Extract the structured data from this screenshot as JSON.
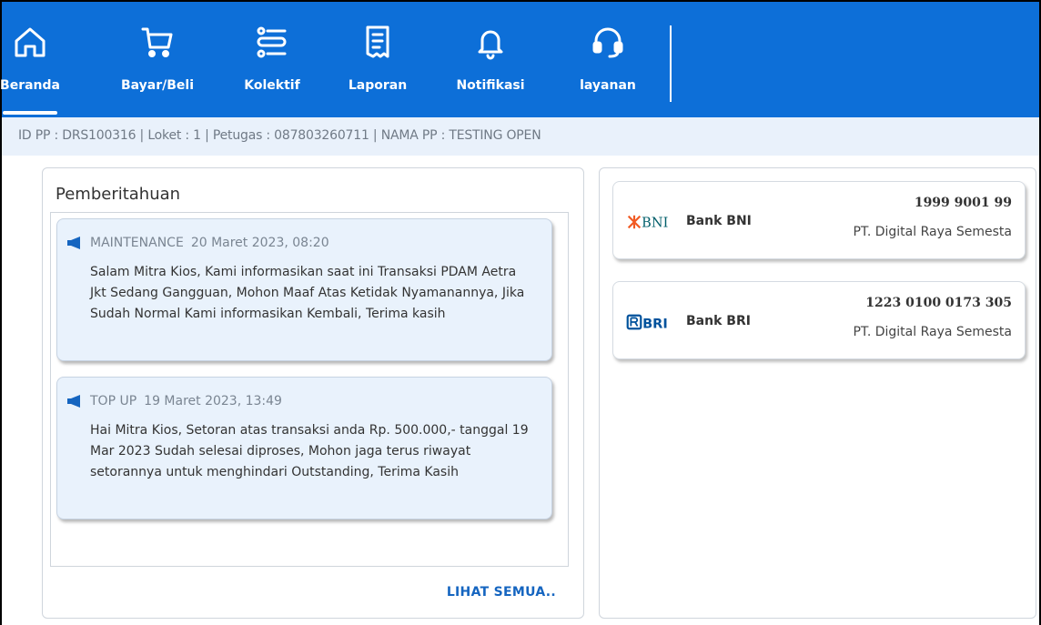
{
  "nav": {
    "items": [
      {
        "label": "Beranda",
        "icon": "home-icon"
      },
      {
        "label": "Bayar/Beli",
        "icon": "cart-icon"
      },
      {
        "label": "Kolektif",
        "icon": "list-icon"
      },
      {
        "label": "Laporan",
        "icon": "report-icon"
      },
      {
        "label": "Notifikasi",
        "icon": "bell-icon"
      },
      {
        "label": "layanan",
        "icon": "headset-icon"
      }
    ],
    "active": "Beranda"
  },
  "info_bar": {
    "text": "ID PP : DRS100316 | Loket : 1 | Petugas : 087803260711 | NAMA PP : TESTING OPEN"
  },
  "announcements": {
    "title": "Pemberitahuan",
    "items": [
      {
        "category": "MAINTENANCE",
        "datetime": "20 Maret 2023, 08:20",
        "message": "Salam Mitra Kios, Kami informasikan saat ini Transaksi PDAM Aetra Jkt Sedang Gangguan, Mohon Maaf Atas Ketidak Nyamanannya, Jika Sudah Normal Kami informasikan Kembali, Terima kasih"
      },
      {
        "category": "TOP UP",
        "datetime": "19 Maret 2023, 13:49",
        "message": "Hai Mitra Kios, Setoran atas transaksi anda Rp. 500.000,- tanggal 19 Mar 2023 Sudah selesai diproses, Mohon jaga terus riwayat setorannya untuk menghindari Outstanding, Terima Kasih"
      }
    ],
    "see_all": "LIHAT SEMUA.."
  },
  "banks": [
    {
      "logo_text": "BNI",
      "name": "Bank BNI",
      "account_number": "1999 9001 99",
      "account_owner": "PT. Digital Raya Semesta"
    },
    {
      "logo_text": "BRI",
      "name": "Bank BRI",
      "account_number": "1223 0100 0173 305",
      "account_owner": "PT. Digital Raya Semesta"
    }
  ],
  "colors": {
    "nav_bg": "#0d6fd8",
    "info_bg": "#e9f1fb",
    "card_bg": "#e9f2fc",
    "link": "#1565c0",
    "bni_orange": "#f15a23",
    "bni_teal": "#005e6a",
    "bri_blue": "#00529c"
  }
}
